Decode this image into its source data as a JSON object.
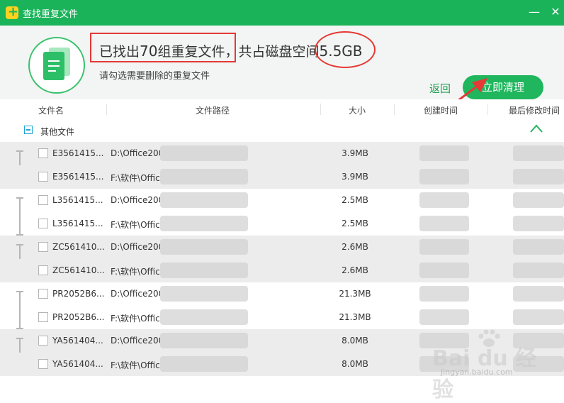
{
  "window": {
    "title": "查找重复文件",
    "minimize": "—",
    "close": "✕"
  },
  "summary": {
    "headline_prefix": "已找出",
    "group_count": "70",
    "headline_mid": "组重复文件，共占磁盘空间",
    "total_size": "5.5GB",
    "subtitle": "请勾选需要删除的重复文件",
    "back_label": "返回",
    "clean_label": "立即清理"
  },
  "columns": [
    "文件名",
    "文件路径",
    "大小",
    "创建时间",
    "最后修改时间"
  ],
  "group": {
    "label": "其他文件"
  },
  "files": [
    {
      "name": "E3561415...",
      "path": "D:\\Office200",
      "size": "3.9MB"
    },
    {
      "name": "E3561415...",
      "path": "F:\\软件\\Offic",
      "size": "3.9MB"
    },
    {
      "name": "L3561415...",
      "path": "D:\\Office200",
      "size": "2.5MB"
    },
    {
      "name": "L3561415...",
      "path": "F:\\软件\\Offic",
      "size": "2.5MB"
    },
    {
      "name": "ZC561410...",
      "path": "D:\\Office200",
      "size": "2.6MB"
    },
    {
      "name": "ZC561410...",
      "path": "F:\\软件\\Offic",
      "size": "2.6MB"
    },
    {
      "name": "PR2052B6...",
      "path": "D:\\Office200",
      "size": "21.3MB"
    },
    {
      "name": "PR2052B6...",
      "path": "F:\\软件\\Offic",
      "size": "21.3MB"
    },
    {
      "name": "YA561404...",
      "path": "D:\\Office200",
      "size": "8.0MB"
    },
    {
      "name": "YA561404...",
      "path": "F:\\软件\\Offic",
      "size": "8.0MB"
    }
  ],
  "watermark": {
    "brand": "Bai du 经验",
    "url": "jingyan.baidu.com"
  },
  "colors": {
    "brand_green": "#1bb35a",
    "annotation_red": "#e53935",
    "row_shade": "#ececec"
  },
  "icons": [
    "app-logo-icon",
    "document-stack-icon",
    "chevron-up-icon",
    "close-icon",
    "minimize-icon"
  ]
}
